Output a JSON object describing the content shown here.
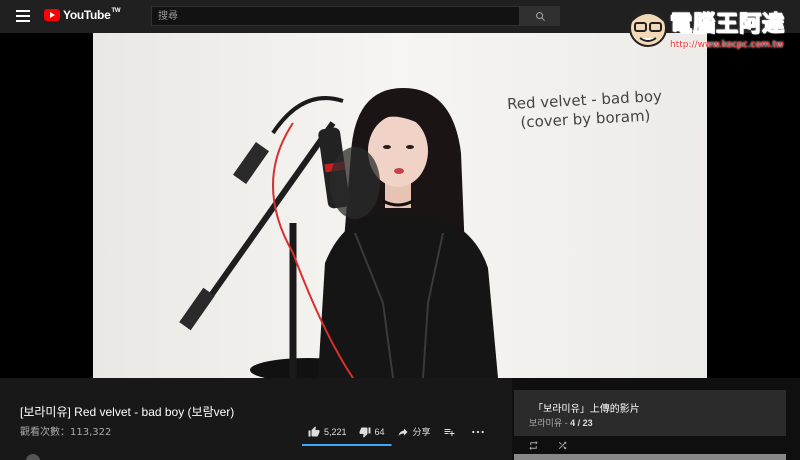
{
  "header": {
    "logo_text": "YouTube",
    "logo_tm": "TW",
    "search_placeholder": "搜尋"
  },
  "watermark": {
    "title": "電腦王阿達",
    "url": "http://www.kocpc.com.tw"
  },
  "video": {
    "overlay_line1": "Red velvet - bad boy",
    "overlay_line2": "(cover by boram)"
  },
  "info": {
    "title": "[보라미유] Red velvet - bad boy (보람ver)",
    "views": "觀看次數：113,322",
    "likes": "5,221",
    "dislikes": "64",
    "share_label": "分享",
    "like_ratio": 0.988
  },
  "playlist": {
    "title": "「보라미유」上傳的影片",
    "channel": "보라미유",
    "position": "4 / 23"
  },
  "colors": {
    "brand_red": "#ff0000",
    "background": "#0f0f0f",
    "accent_blue": "#3ea6ff"
  },
  "icons": [
    "menu-icon",
    "search-icon",
    "like-icon",
    "dislike-icon",
    "share-icon",
    "add-to-playlist-icon",
    "more-icon",
    "loop-icon",
    "shuffle-icon"
  ]
}
